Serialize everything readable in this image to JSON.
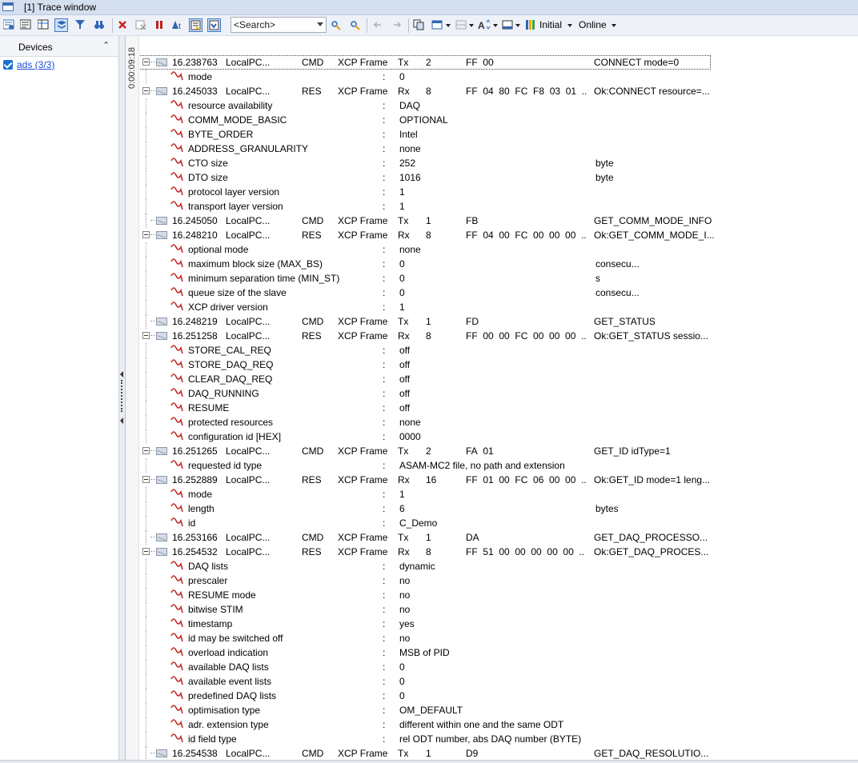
{
  "window": {
    "title": "[1] Trace window"
  },
  "toolbar": {
    "search_placeholder": "<Search>",
    "initial_label": "Initial",
    "online_label": "Online"
  },
  "left_panel": {
    "header": "Devices",
    "device": "ads (3/3)"
  },
  "time_marker": "0:00:09:18",
  "trace": {
    "rows": [
      {
        "kind": "frame",
        "time": "16.238763",
        "source": "LocalPC...",
        "type": "CMD",
        "frame": "XCP Frame",
        "dir": "Tx",
        "dlc": "2",
        "data": "FF  00",
        "comment": "CONNECT mode=0",
        "expanded": true
      },
      {
        "kind": "signal",
        "name": "mode",
        "value": "0"
      },
      {
        "kind": "frame",
        "time": "16.245033",
        "source": "LocalPC...",
        "type": "RES",
        "frame": "XCP Frame",
        "dir": "Rx",
        "dlc": "8",
        "data": "FF  04  80  FC  F8  03  01  ..",
        "comment": "Ok:CONNECT resource=...",
        "expanded": true
      },
      {
        "kind": "signal",
        "name": "resource availability",
        "value": "DAQ"
      },
      {
        "kind": "signal",
        "name": "COMM_MODE_BASIC",
        "value": "OPTIONAL"
      },
      {
        "kind": "signal",
        "name": "BYTE_ORDER",
        "value": "Intel"
      },
      {
        "kind": "signal",
        "name": "ADDRESS_GRANULARITY",
        "value": "none"
      },
      {
        "kind": "signal",
        "name": "CTO size",
        "value": "252",
        "unit": "byte"
      },
      {
        "kind": "signal",
        "name": "DTO size",
        "value": "1016",
        "unit": "byte"
      },
      {
        "kind": "signal",
        "name": "protocol layer version",
        "value": "1"
      },
      {
        "kind": "signal",
        "name": "transport layer version",
        "value": "1"
      },
      {
        "kind": "frame",
        "time": "16.245050",
        "source": "LocalPC...",
        "type": "CMD",
        "frame": "XCP Frame",
        "dir": "Tx",
        "dlc": "1",
        "data": "FB",
        "comment": "GET_COMM_MODE_INFO",
        "expanded": false
      },
      {
        "kind": "frame",
        "time": "16.248210",
        "source": "LocalPC...",
        "type": "RES",
        "frame": "XCP Frame",
        "dir": "Rx",
        "dlc": "8",
        "data": "FF  04  00  FC  00  00  00  ..",
        "comment": "Ok:GET_COMM_MODE_I...",
        "expanded": true
      },
      {
        "kind": "signal",
        "name": "optional mode",
        "value": "none"
      },
      {
        "kind": "signal",
        "name": "maximum block size (MAX_BS)",
        "value": "0",
        "unit": "consecu..."
      },
      {
        "kind": "signal",
        "name": "minimum separation time (MIN_ST)",
        "value": "0",
        "unit": "s"
      },
      {
        "kind": "signal",
        "name": "queue size of the slave",
        "value": "0",
        "unit": "consecu..."
      },
      {
        "kind": "signal",
        "name": "XCP driver version",
        "value": "1"
      },
      {
        "kind": "frame",
        "time": "16.248219",
        "source": "LocalPC...",
        "type": "CMD",
        "frame": "XCP Frame",
        "dir": "Tx",
        "dlc": "1",
        "data": "FD",
        "comment": "GET_STATUS",
        "expanded": false
      },
      {
        "kind": "frame",
        "time": "16.251258",
        "source": "LocalPC...",
        "type": "RES",
        "frame": "XCP Frame",
        "dir": "Rx",
        "dlc": "8",
        "data": "FF  00  00  FC  00  00  00  ..",
        "comment": "Ok:GET_STATUS sessio...",
        "expanded": true
      },
      {
        "kind": "signal",
        "name": "STORE_CAL_REQ",
        "value": "off"
      },
      {
        "kind": "signal",
        "name": "STORE_DAQ_REQ",
        "value": "off"
      },
      {
        "kind": "signal",
        "name": "CLEAR_DAQ_REQ",
        "value": "off"
      },
      {
        "kind": "signal",
        "name": "DAQ_RUNNING",
        "value": "off"
      },
      {
        "kind": "signal",
        "name": "RESUME",
        "value": "off"
      },
      {
        "kind": "signal",
        "name": "protected resources",
        "value": "none"
      },
      {
        "kind": "signal",
        "name": "configuration id [HEX]",
        "value": "0000"
      },
      {
        "kind": "frame",
        "time": "16.251265",
        "source": "LocalPC...",
        "type": "CMD",
        "frame": "XCP Frame",
        "dir": "Tx",
        "dlc": "2",
        "data": "FA  01",
        "comment": "GET_ID idType=1",
        "expanded": true
      },
      {
        "kind": "signal",
        "name": "requested id type",
        "value": "ASAM-MC2 file, no path and extension"
      },
      {
        "kind": "frame",
        "time": "16.252889",
        "source": "LocalPC...",
        "type": "RES",
        "frame": "XCP Frame",
        "dir": "Rx",
        "dlc": "16",
        "data": "FF  01  00  FC  06  00  00  ..",
        "comment": "Ok:GET_ID mode=1 leng...",
        "expanded": true
      },
      {
        "kind": "signal",
        "name": "mode",
        "value": "1"
      },
      {
        "kind": "signal",
        "name": "length",
        "value": "6",
        "unit": "bytes"
      },
      {
        "kind": "signal",
        "name": "id",
        "value": "C_Demo"
      },
      {
        "kind": "frame",
        "time": "16.253166",
        "source": "LocalPC...",
        "type": "CMD",
        "frame": "XCP Frame",
        "dir": "Tx",
        "dlc": "1",
        "data": "DA",
        "comment": "GET_DAQ_PROCESSO...",
        "expanded": false
      },
      {
        "kind": "frame",
        "time": "16.254532",
        "source": "LocalPC...",
        "type": "RES",
        "frame": "XCP Frame",
        "dir": "Rx",
        "dlc": "8",
        "data": "FF  51  00  00  00  00  00  ..",
        "comment": "Ok:GET_DAQ_PROCES...",
        "expanded": true
      },
      {
        "kind": "signal",
        "name": "DAQ lists",
        "value": "dynamic"
      },
      {
        "kind": "signal",
        "name": "prescaler",
        "value": "no"
      },
      {
        "kind": "signal",
        "name": "RESUME mode",
        "value": "no"
      },
      {
        "kind": "signal",
        "name": "bitwise STIM",
        "value": "no"
      },
      {
        "kind": "signal",
        "name": "timestamp",
        "value": "yes"
      },
      {
        "kind": "signal",
        "name": "id may be switched off",
        "value": "no"
      },
      {
        "kind": "signal",
        "name": "overload indication",
        "value": "MSB of PID"
      },
      {
        "kind": "signal",
        "name": "available DAQ lists",
        "value": "0"
      },
      {
        "kind": "signal",
        "name": "available event lists",
        "value": "0"
      },
      {
        "kind": "signal",
        "name": "predefined DAQ lists",
        "value": "0"
      },
      {
        "kind": "signal",
        "name": "optimisation type",
        "value": "OM_DEFAULT"
      },
      {
        "kind": "signal",
        "name": "adr. extension type",
        "value": "different within one and the same ODT"
      },
      {
        "kind": "signal",
        "name": "id field type",
        "value": "rel ODT number, abs DAQ number (BYTE)"
      },
      {
        "kind": "frame",
        "time": "16.254538",
        "source": "LocalPC...",
        "type": "CMD",
        "frame": "XCP Frame",
        "dir": "Tx",
        "dlc": "1",
        "data": "D9",
        "comment": "GET_DAQ_RESOLUTIO...",
        "expanded": false
      }
    ]
  }
}
